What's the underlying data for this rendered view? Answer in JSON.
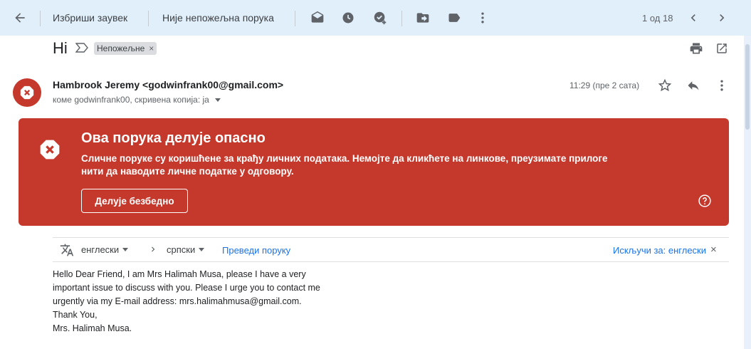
{
  "toolbar": {
    "back_icon": "arrow-back-icon",
    "delete_label": "Избриши заувек",
    "not_spam_label": "Није непожељна порука",
    "icons": [
      "mark-unread-icon",
      "snooze-clock-icon",
      "add-task-icon",
      "move-to-icon",
      "label-icon",
      "more-vert-icon"
    ],
    "pager": "1 од 18"
  },
  "subject": {
    "title": "Hi",
    "label": "Непожељне",
    "label_remove": "×"
  },
  "sender": {
    "from": "Hambrook Jeremy <godwinfrank00@gmail.com>",
    "to": "коме godwinfrank00, скривена копија: ја",
    "time": "11:29 (пре 2 сата)"
  },
  "warning": {
    "title": "Ова порука делује опасно",
    "body": "Сличне поруке су коришћене за крађу личних података. Немојте да кликћете на линкове, преузимате прилоге нити да наводите личне податке у одговору.",
    "button": "Делује безбедно",
    "color": "#c5382c"
  },
  "translate": {
    "from_lang": "енглески",
    "to_lang": "српски",
    "translate_link": "Преведи поруку",
    "turn_off": "Искључи за: енглески",
    "close": "×"
  },
  "body": {
    "lines": [
      "Hello Dear Friend, I am Mrs Halimah Musa, please I have a very",
      "important issue to discuss with you. Please I urge you to contact me",
      "urgently via my E-mail address: mrs.halimahmusa@gmail.com.",
      "Thank You,",
      "Mrs. Halimah Musa."
    ]
  }
}
